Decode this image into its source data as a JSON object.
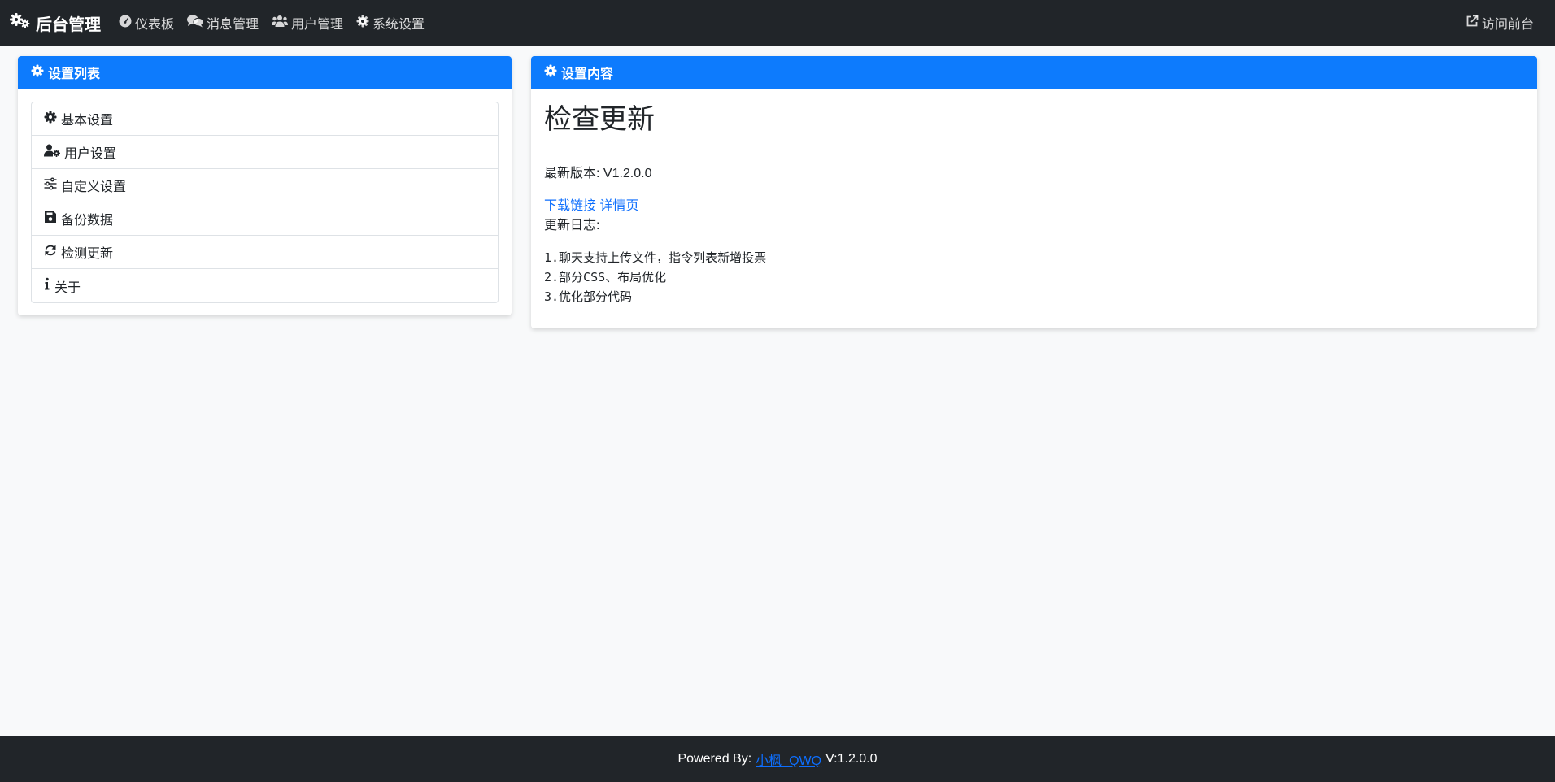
{
  "navbar": {
    "brand": "后台管理",
    "items": [
      {
        "label": "仪表板",
        "icon": "dashboard-icon"
      },
      {
        "label": "消息管理",
        "icon": "comments-icon"
      },
      {
        "label": "用户管理",
        "icon": "users-icon"
      },
      {
        "label": "系统设置",
        "icon": "gear-icon"
      }
    ],
    "right": {
      "label": "访问前台",
      "icon": "external-link-icon"
    }
  },
  "settings_list": {
    "header": "设置列表",
    "items": [
      {
        "label": "基本设置",
        "icon": "gear-icon"
      },
      {
        "label": "用户设置",
        "icon": "user-gear-icon"
      },
      {
        "label": "自定义设置",
        "icon": "sliders-icon"
      },
      {
        "label": "备份数据",
        "icon": "save-icon"
      },
      {
        "label": "检测更新",
        "icon": "refresh-icon"
      },
      {
        "label": "关于",
        "icon": "info-icon"
      }
    ]
  },
  "content": {
    "header": "设置内容",
    "title": "检查更新",
    "version_line": "最新版本: V1.2.0.0",
    "download_link": "下载链接",
    "detail_link": "详情页",
    "log_label": "更新日志:",
    "log": [
      "1.聊天支持上传文件，指令列表新增投票",
      "2.部分CSS、布局优化",
      "3.优化部分代码"
    ]
  },
  "footer": {
    "prefix": "Powered By:",
    "author": "小枫_QWQ",
    "version": "V:1.2.0.0"
  }
}
